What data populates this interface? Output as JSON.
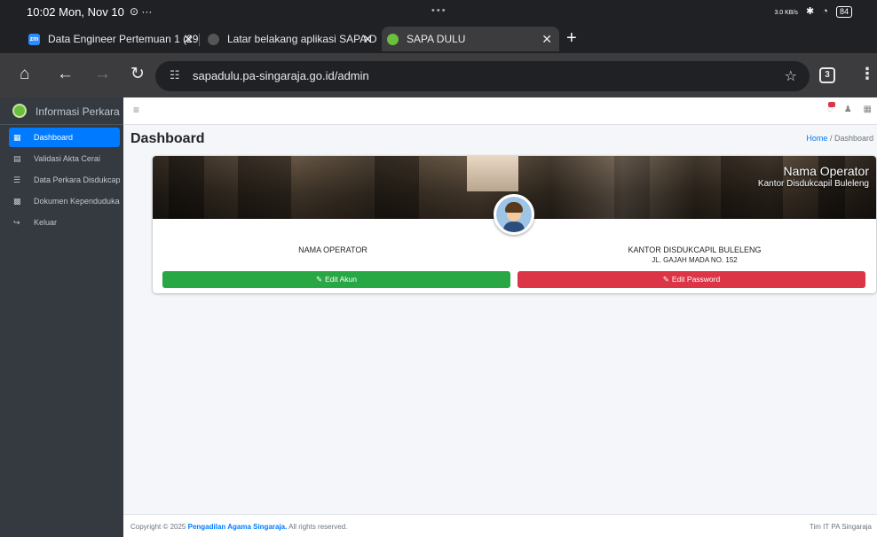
{
  "status_bar": {
    "time": "10:02 Mon, Nov 10",
    "extra": "⊙ ···",
    "center": "•••",
    "net": "3.0 KB/s",
    "battery": "84"
  },
  "tabs": [
    {
      "label": "Data Engineer Pertemuan 1 (29",
      "favicon": "zm",
      "favicon_color": "#2d8cff",
      "close": "✕"
    },
    {
      "label": "Latar belakang aplikasi SAPA D",
      "favicon": "",
      "favicon_color": "#555555",
      "close": "✕"
    },
    {
      "label": "SAPA DULU",
      "favicon": "",
      "favicon_color": "#6bbf3f",
      "close": "✕"
    }
  ],
  "new_tab": "+",
  "toolbar": {
    "url": "sapadulu.pa-singaraja.go.id/admin",
    "tab_count": "3"
  },
  "sidebar": {
    "brand": "Informasi Perkara",
    "items": [
      {
        "label": "Dashboard",
        "icon": "th-icon",
        "glyph": "▦"
      },
      {
        "label": "Validasi Akta Cerai",
        "icon": "clipboard-icon",
        "glyph": "▤"
      },
      {
        "label": "Data Perkara Disdukcapil",
        "icon": "database-icon",
        "glyph": "☰"
      },
      {
        "label": "Dokumen Kependudukan",
        "icon": "file-icon",
        "glyph": "▩"
      },
      {
        "label": "Keluar",
        "icon": "sign-out-icon",
        "glyph": "↪"
      }
    ]
  },
  "header": {
    "title": "Dashboard",
    "breadcrumb_home": "Home",
    "breadcrumb_sep": "/",
    "breadcrumb_current": "Dashboard"
  },
  "profile": {
    "banner_name": "Nama Operator",
    "banner_office": "Kantor Disdukcapil Buleleng",
    "left_label": "NAMA OPERATOR",
    "right_label": "KANTOR DISDUKCAPIL BULELENG",
    "right_address": "JL. GAJAH MADA NO. 152",
    "edit_account": "Edit Akun",
    "edit_password": "Edit Password"
  },
  "footer": {
    "copy_prefix": "Copyright © 2025",
    "org": "Pengadilan Agama Singaraja.",
    "rights": "All rights reserved.",
    "team": "Tim IT PA Singaraja"
  },
  "colors": {
    "accent": "#007bff",
    "success": "#28a745",
    "danger": "#dc3545",
    "sidebar": "#343a40"
  }
}
